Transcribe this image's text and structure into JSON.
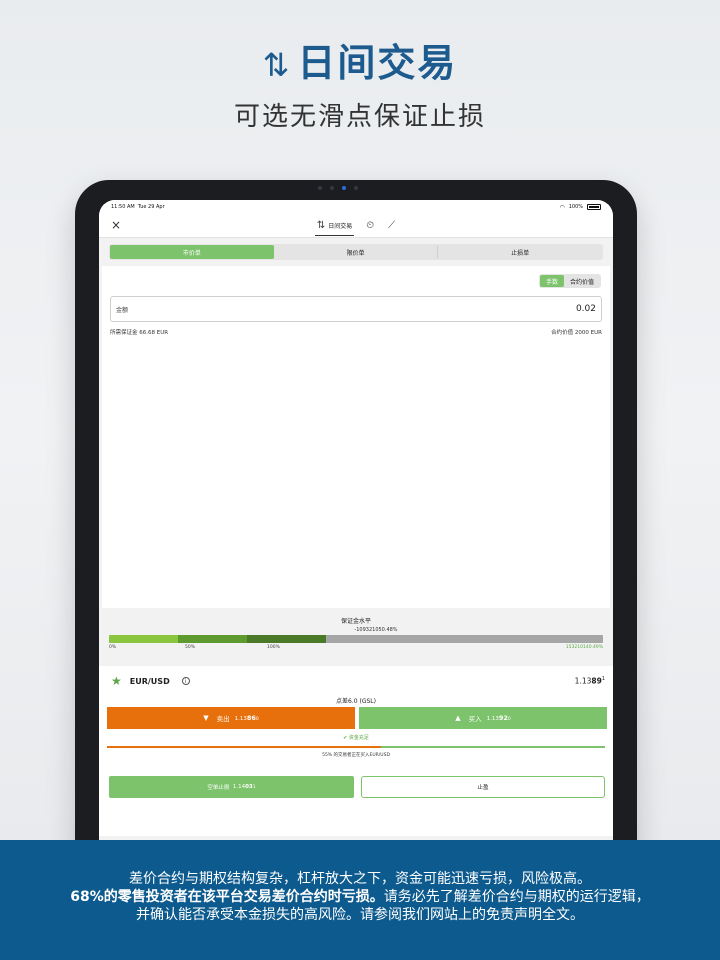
{
  "promo": {
    "title_icon": "⇅",
    "title": "日间交易",
    "subtitle": "可选无滑点保证止损"
  },
  "status_bar": {
    "time": "11:50 AM",
    "date": "Tue 29 Apr",
    "battery": "100%"
  },
  "nav": {
    "close_icon": "×",
    "tabs": [
      {
        "icon": "⇅",
        "label": "日间交易",
        "active": true
      },
      {
        "icon": "⏲",
        "label": "",
        "active": false
      },
      {
        "icon": "⟋",
        "label": "",
        "active": false
      }
    ]
  },
  "order_tabs": [
    {
      "label": "市价单",
      "active": true
    },
    {
      "label": "限价单",
      "active": false
    },
    {
      "label": "止损单",
      "active": false
    }
  ],
  "unit_toggle": {
    "lots": "手数",
    "contract_value": "合约价值"
  },
  "amount": {
    "label": "金额",
    "value": "0.02"
  },
  "margin_info": {
    "required_margin": "所需保证金 66.68 EUR",
    "contract_value": "合约价值 2000 EUR"
  },
  "margin_level": {
    "title": "保证金水平",
    "current": "-109321050.48%",
    "ticks": [
      "0%",
      "50%",
      "100%"
    ],
    "max": "15321014 0.49%",
    "max_display": "153210140.49%",
    "segments_pct": [
      0.14,
      0.28,
      0.44
    ]
  },
  "instrument": {
    "star_icon": "★",
    "name": "EUR/USD",
    "info_icon": "i",
    "price_main": "1.13",
    "price_big": "89",
    "price_small": "1"
  },
  "spread": "点差6.0 (GSL)",
  "sell": {
    "label": "卖出",
    "price_main": "1.13",
    "price_big": "86",
    "price_small": "0"
  },
  "buy": {
    "label": "买入",
    "price_main": "1.13",
    "price_big": "92",
    "price_small": "0"
  },
  "funds_ok": "资金充足",
  "sentiment": {
    "text": "55% 的交易者正在买入EUR/USD",
    "buy_fraction": 0.55
  },
  "stop_loss_button": {
    "label": "空单止损",
    "price_main": "1.14",
    "price_big": "03",
    "price_small": "1"
  },
  "take_profit_button": {
    "label": "止盈"
  },
  "disclaimer": {
    "line1": "差价合约与期权结构复杂，杠杆放大之下，资金可能迅速亏损，风险极高。",
    "line2_bold": "68%的零售投资者在该平台交易差价合约时亏损。",
    "line2_rest": "请务必先了解差价合约与期权的运行逻辑，",
    "line3": "并确认能否承受本金损失的高风险。请参阅我们网站上的免责声明全文。"
  },
  "colors": {
    "brand_blue": "#0d5a8e",
    "green": "#7cc36b",
    "orange": "#e8700c"
  }
}
